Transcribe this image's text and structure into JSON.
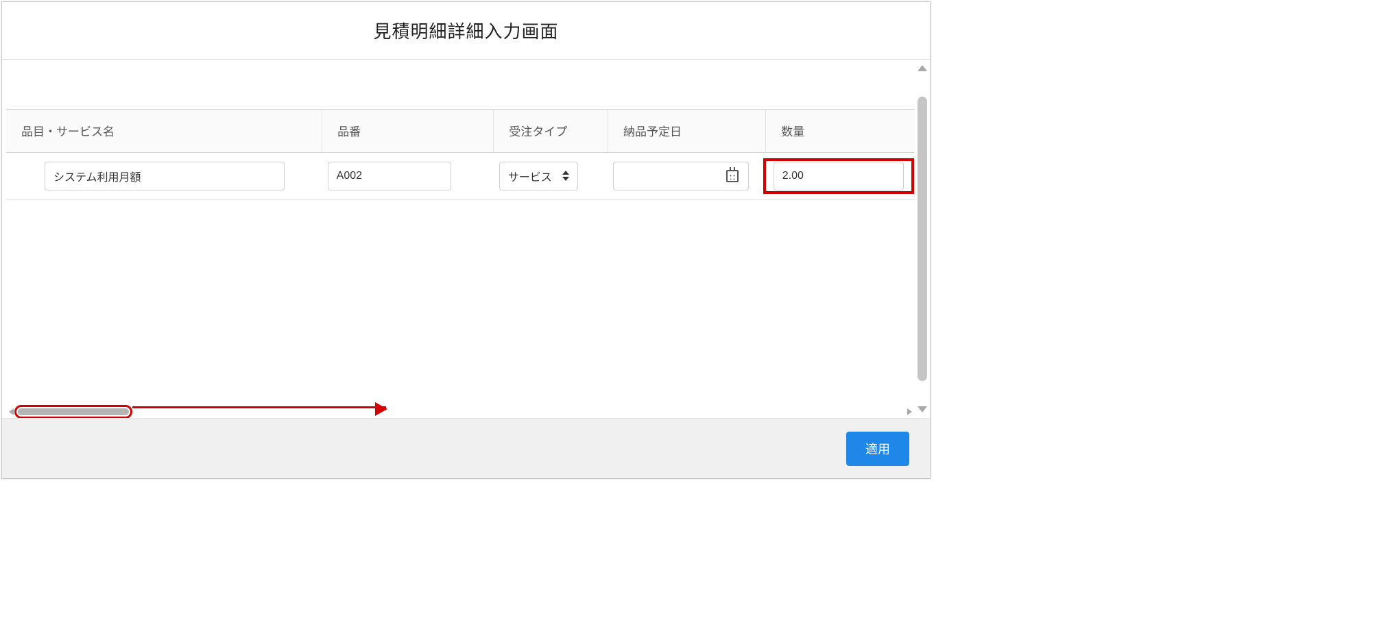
{
  "dialog": {
    "title": "見積明細詳細入力画面"
  },
  "grid": {
    "columns": {
      "name": "品目・サービス名",
      "code": "品番",
      "type": "受注タイプ",
      "date": "納品予定日",
      "qty": "数量"
    },
    "row": {
      "name": "システム利用月額",
      "code": "A002",
      "type": "サービス",
      "date": "",
      "qty": "2.00"
    }
  },
  "footer": {
    "apply": "適用"
  }
}
